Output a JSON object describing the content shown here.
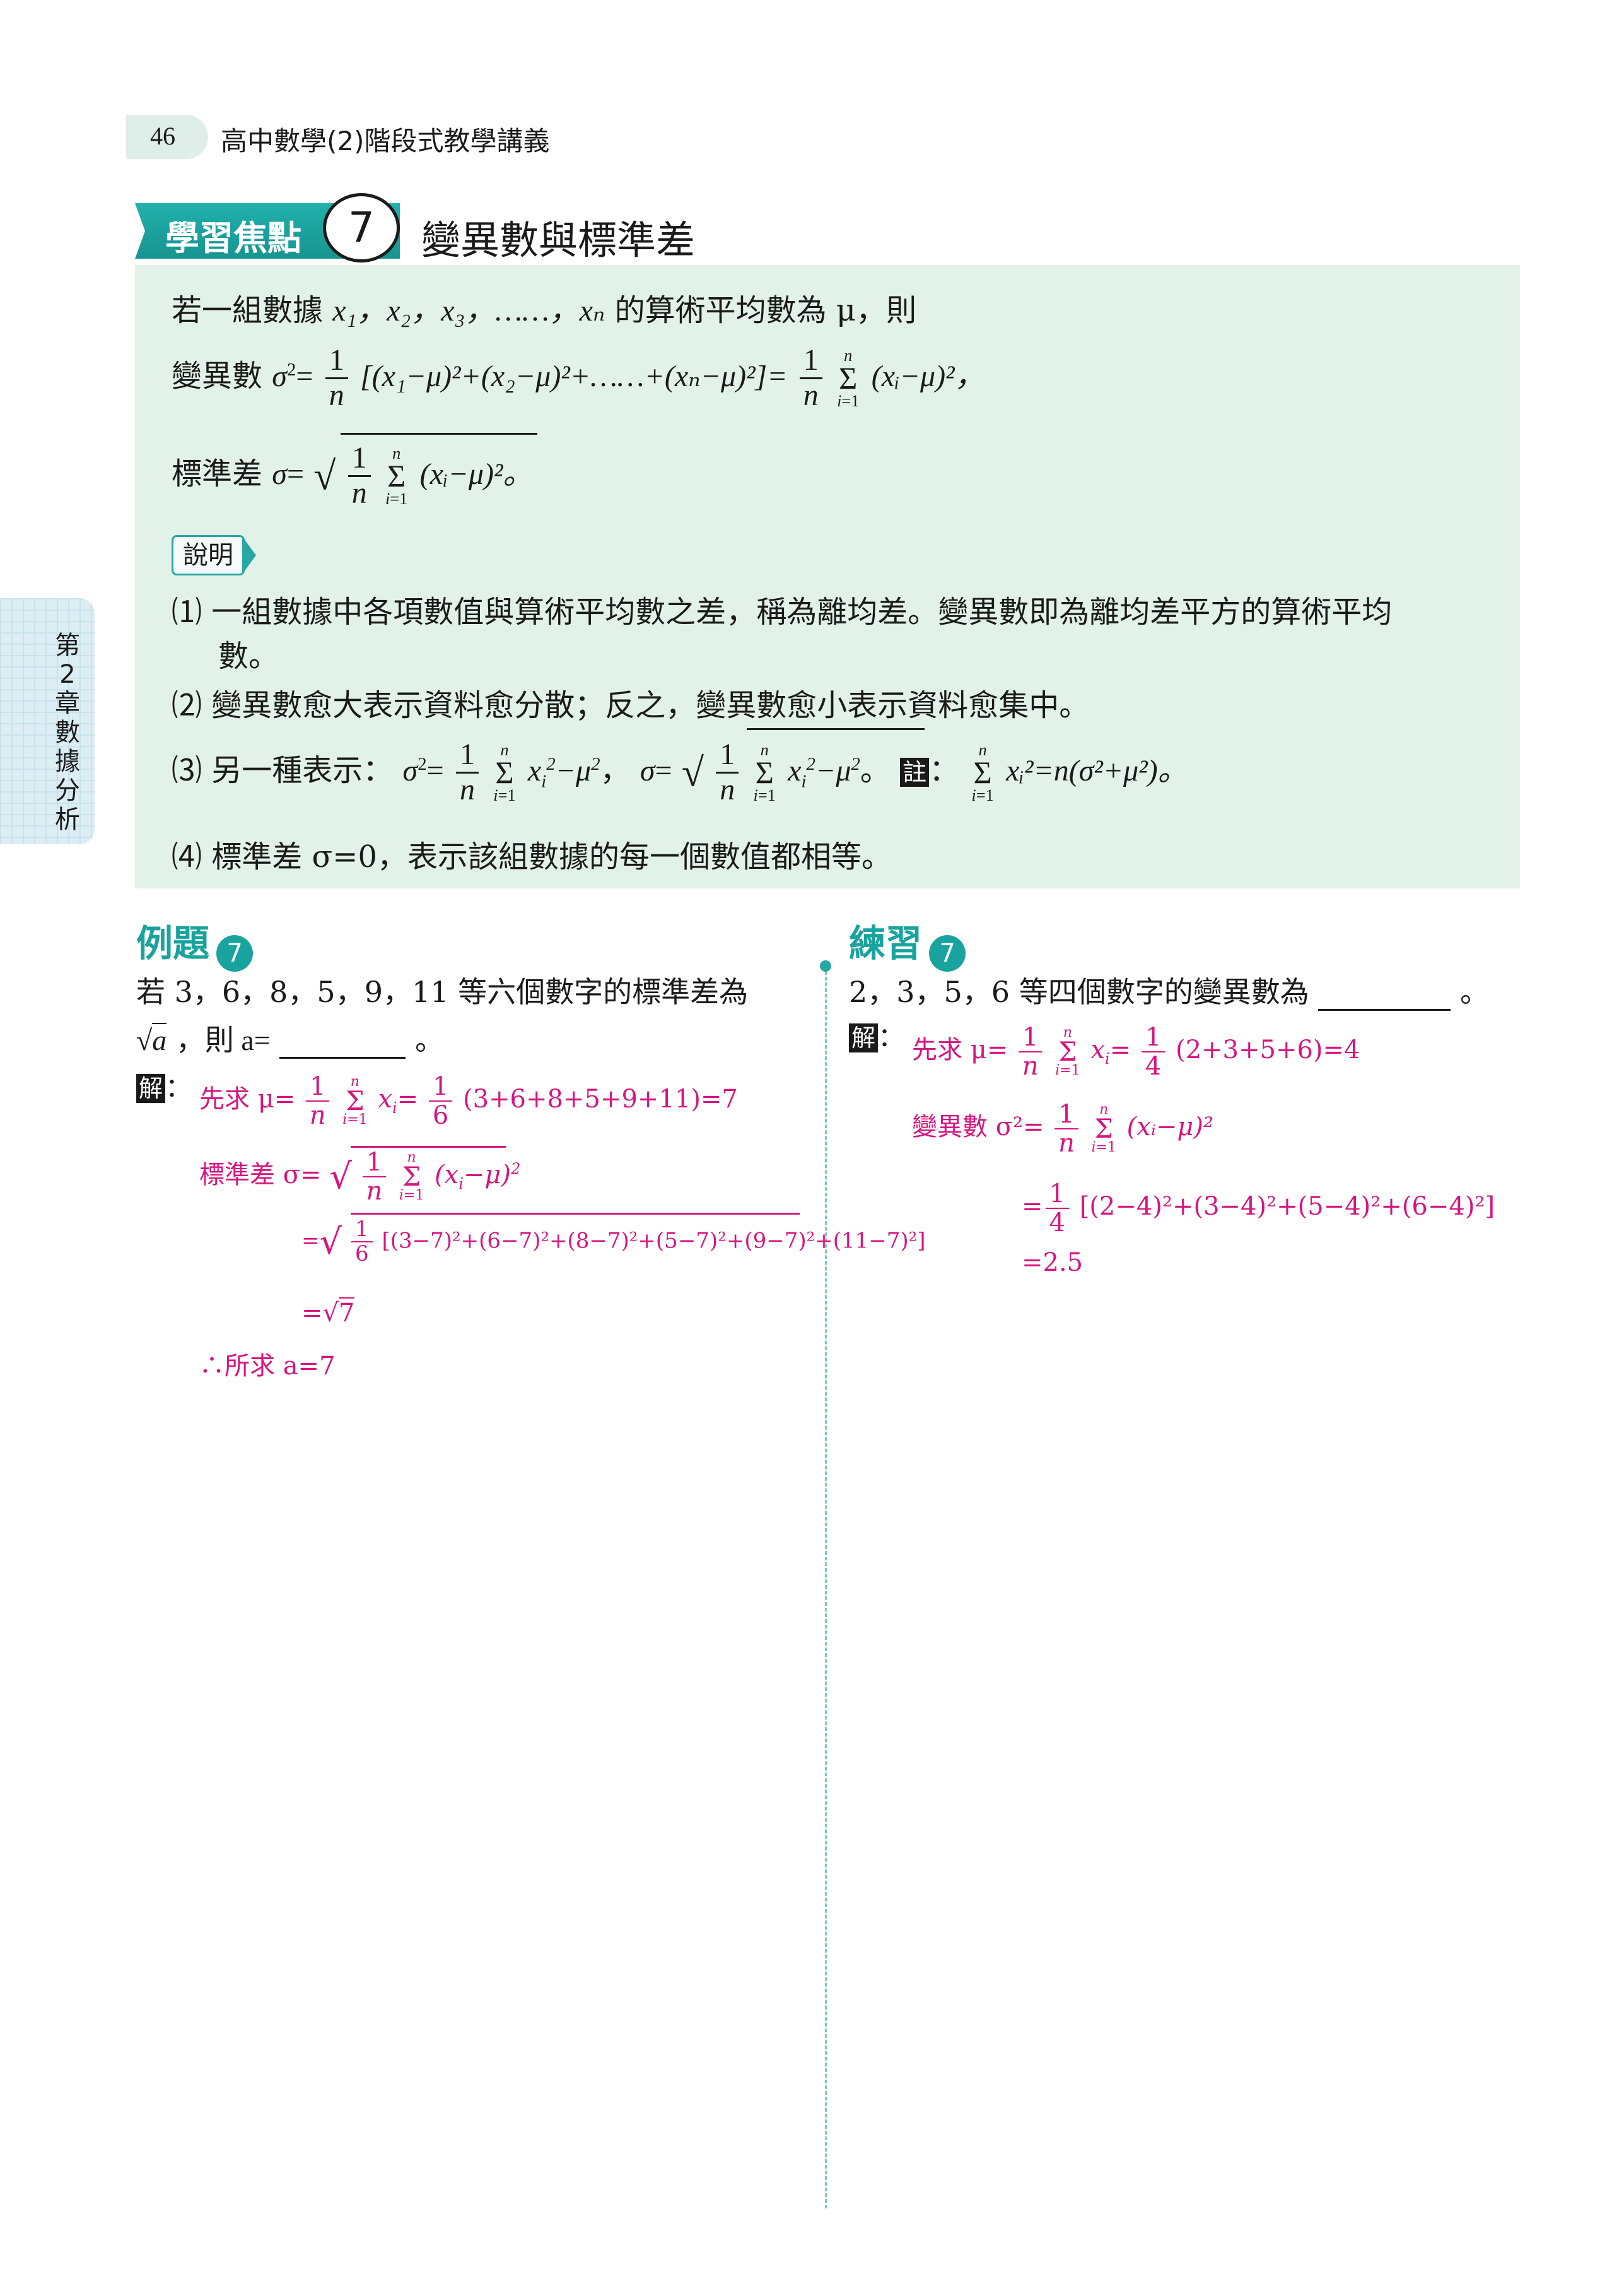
{
  "header": {
    "page_number": "46",
    "book_title": "高中數學(2)階段式教學講義"
  },
  "section": {
    "badge_label": "學習焦點",
    "number": "7",
    "title": "變異數與標準差"
  },
  "concept": {
    "intro_prefix": "若一組數據",
    "intro_vars": "x₁，x₂，x₃，……，xₙ",
    "intro_suffix": "的算術平均數為 μ，則",
    "variance_label": "變異數",
    "variance_expr": "[(x₁−μ)²+(x₂−μ)²+……+(xₙ−μ)²]=",
    "variance_tail": "(xᵢ−μ)²，",
    "std_label": "標準差",
    "std_tail": "(xᵢ−μ)²。",
    "explain_badge": "說明",
    "points": [
      "⑴ 一組數據中各項數值與算術平均數之差，稱為離均差。變異數即為離均差平方的算術平均",
      "數。",
      "⑵ 變異數愈大表示資料愈分散；反之，變異數愈小表示資料愈集中。",
      "⑶ 另一種表示：",
      "⑷ 標準差 σ=0，表示該組數據的每一個數值都相等。"
    ],
    "note_label": "註",
    "note_expr": "xᵢ²=n(σ²+μ²)。"
  },
  "side_tab": {
    "text": "第2章 數據分析"
  },
  "example": {
    "label": "例題",
    "number": "7",
    "question_line1": "若 3，6，8，5，9，11 等六個數字的標準差為",
    "question_line2_prefix": "a",
    "question_line2_suffix": "，則 a=",
    "question_end": "。",
    "solve_label": "解",
    "steps": [
      "先求 μ=",
      "(3+6+8+5+9+11)=7",
      "標準差 σ=",
      "[(3−7)²+(6−7)²+(8−7)²+(5−7)²+(9−7)²+(11−7)²]",
      "=",
      "7",
      "∴所求 a=7"
    ]
  },
  "practice": {
    "label": "練習",
    "number": "7",
    "question": "2，3，5，6 等四個數字的變異數為",
    "question_end": "。",
    "solve_label": "解",
    "steps": [
      "先求 μ=",
      "(2+3+5+6)=4",
      "變異數 σ²=",
      "(xᵢ−μ)²",
      "[(2−4)²+(3−4)²+(5−4)²+(6−4)²]",
      "=2.5"
    ]
  }
}
